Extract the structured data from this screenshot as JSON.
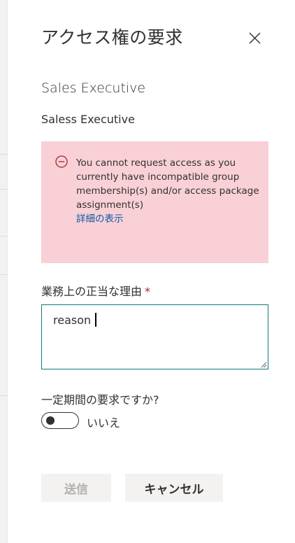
{
  "panel": {
    "title": "アクセス権の要求",
    "close_icon": "close-icon"
  },
  "item": {
    "name": "Sales Executive",
    "description": "Saless Executive"
  },
  "error": {
    "icon": "error-circle-icon",
    "message": "You cannot request access as you currently have incompatible group membership(s) and/or access package assignment(s)",
    "link": "詳細の表示",
    "background_color": "#f8d0d6",
    "link_color": "#0f5aa8"
  },
  "justification": {
    "label": "業務上の正当な理由",
    "required_marker": "*",
    "value": "reason"
  },
  "duration": {
    "question": "一定期間の要求ですか?",
    "toggle_state_label": "いいえ",
    "toggle_on": false
  },
  "actions": {
    "submit_label": "送信",
    "cancel_label": "キャンセル"
  }
}
